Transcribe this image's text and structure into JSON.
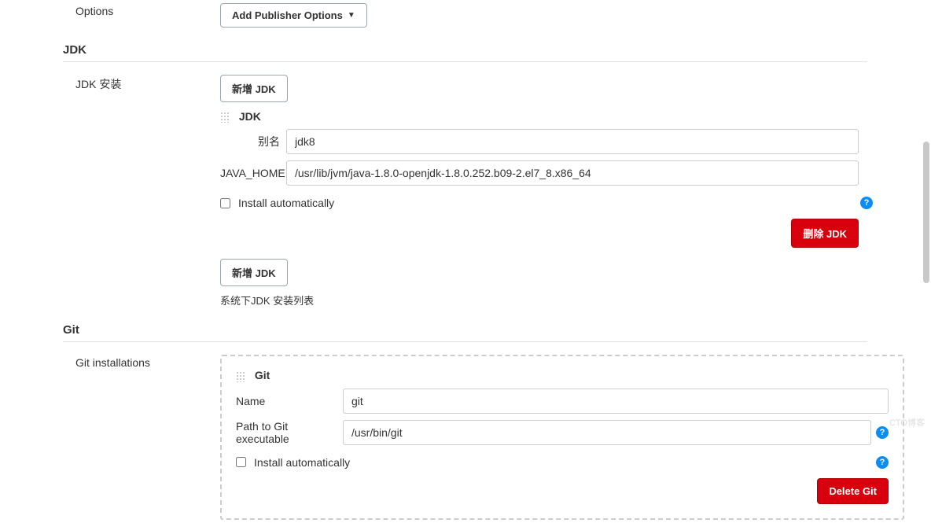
{
  "options": {
    "label": "Options",
    "button": "Add Publisher Options"
  },
  "jdk": {
    "section_title": "JDK",
    "install_label": "JDK 安装",
    "add_button": "新增 JDK",
    "tool_title": "JDK",
    "alias_label": "别名",
    "alias_value": "jdk8",
    "home_label": "JAVA_HOME",
    "home_value": "/usr/lib/jvm/java-1.8.0-openjdk-1.8.0.252.b09-2.el7_8.x86_64",
    "install_auto_label": "Install automatically",
    "delete_button": "删除 JDK",
    "add_button2": "新增 JDK",
    "list_desc": "系统下JDK 安装列表"
  },
  "git": {
    "section_title": "Git",
    "install_label": "Git installations",
    "tool_title": "Git",
    "name_label": "Name",
    "name_value": "git",
    "path_label": "Path to Git executable",
    "path_value": "/usr/bin/git",
    "install_auto_label": "Install automatically",
    "delete_button": "Delete Git"
  },
  "help_glyph": "?",
  "watermark": "CTO博客"
}
